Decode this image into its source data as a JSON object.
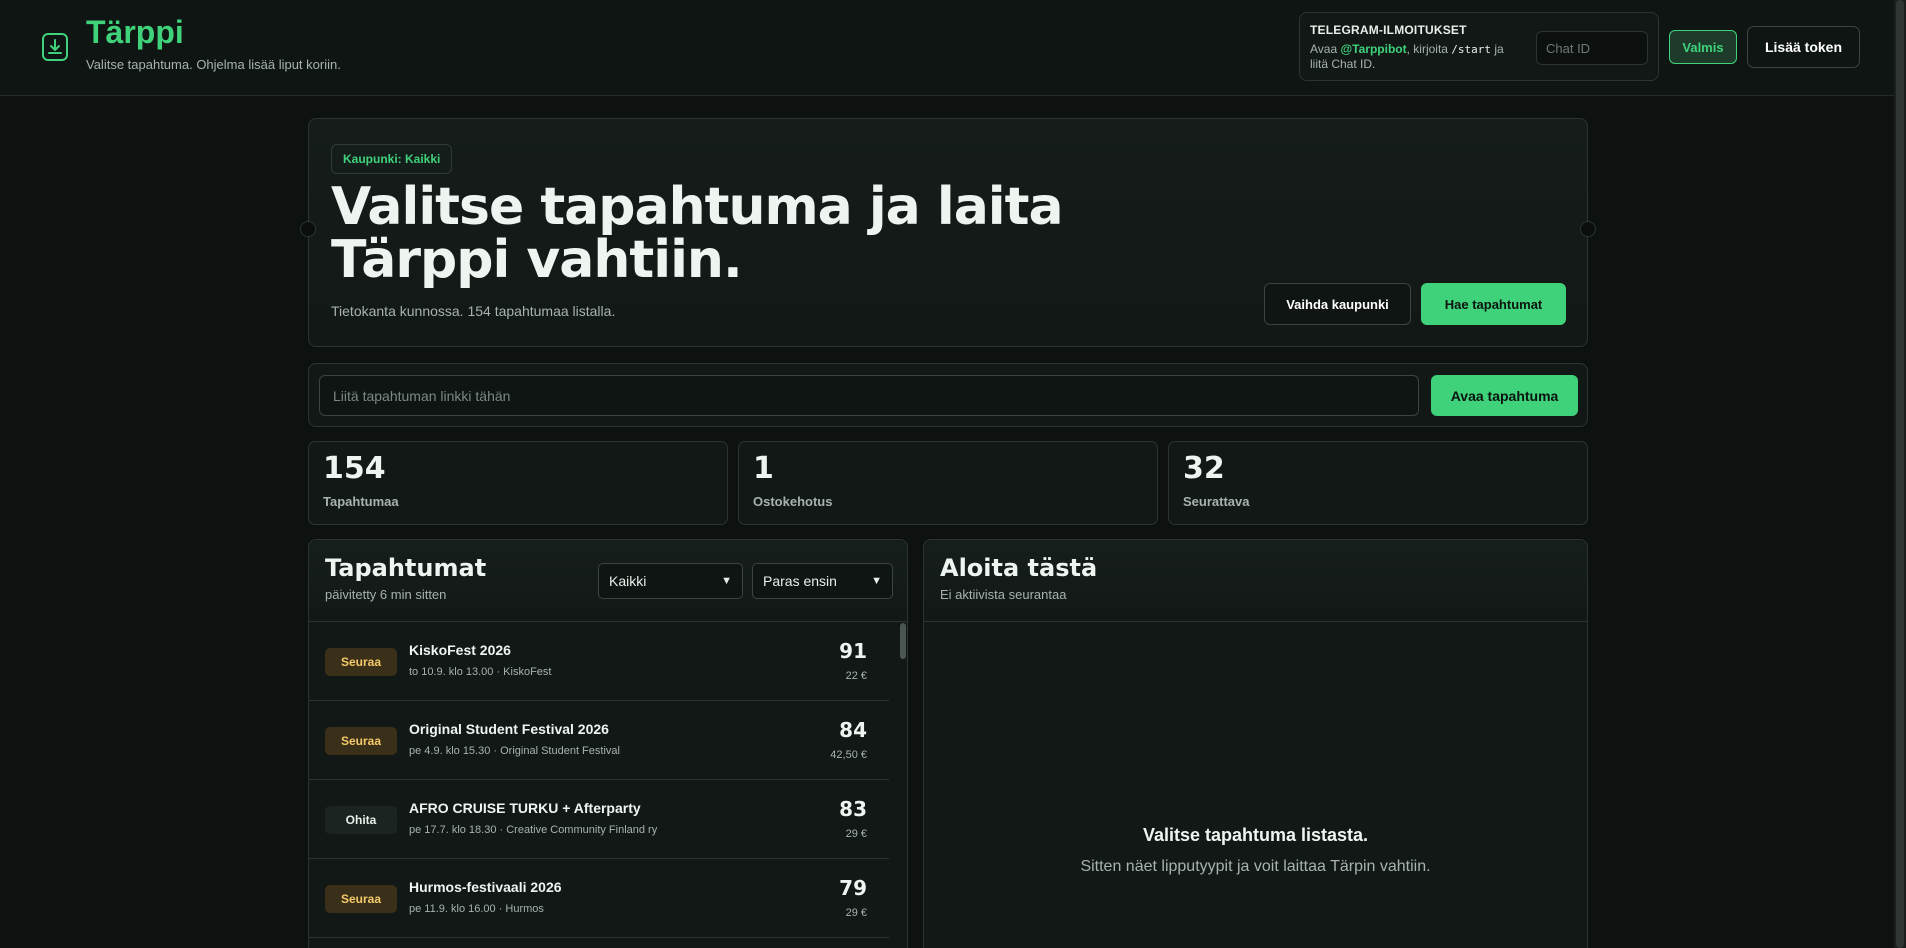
{
  "header": {
    "brand": "Tärppi",
    "subtitle": "Valitse tapahtuma. Ohjelma lisää liput koriin.",
    "telegram": {
      "title": "TELEGRAM-ILMOITUKSET",
      "text_before": "Avaa ",
      "bot": "@Tarppibot",
      "text_mid": ", kirjoita ",
      "command": "/start",
      "text_after": " ja liitä Chat ID.",
      "chat_placeholder": "Chat ID"
    },
    "valmis_label": "Valmis",
    "token_label": "Lisää token"
  },
  "hero": {
    "city_badge": "Kaupunki: Kaikki",
    "title": "Valitse tapahtuma ja laita Tärppi vahtiin.",
    "subtitle": "Tietokanta kunnossa. 154 tapahtumaa listalla.",
    "change_city_label": "Vaihda kaupunki",
    "fetch_label": "Hae tapahtumat"
  },
  "linkbar": {
    "placeholder": "Liitä tapahtuman linkki tähän",
    "open_label": "Avaa tapahtuma"
  },
  "stats": [
    {
      "value": "154",
      "label": "Tapahtumaa"
    },
    {
      "value": "1",
      "label": "Ostokehotus"
    },
    {
      "value": "32",
      "label": "Seurattava"
    }
  ],
  "events_panel": {
    "title": "Tapahtumat",
    "updated": "päivitetty 6 min sitten",
    "filter_selected": "Kaikki",
    "sort_selected": "Paras ensin",
    "events": [
      {
        "badge": "Seuraa",
        "name": "KiskoFest 2026",
        "meta": "to 10.9. klo 13.00 · KiskoFest",
        "score": "91",
        "price": "22 €"
      },
      {
        "badge": "Seuraa",
        "name": "Original Student Festival 2026",
        "meta": "pe 4.9. klo 15.30 · Original Student Festival",
        "score": "84",
        "price": "42,50 €"
      },
      {
        "badge": "Ohita",
        "name": "AFRO CRUISE TURKU + Afterparty",
        "meta": "pe 17.7. klo 18.30 · Creative Community Finland ry",
        "score": "83",
        "price": "29 €"
      },
      {
        "badge": "Seuraa",
        "name": "Hurmos-festivaali 2026",
        "meta": "pe 11.9. klo 16.00 · Hurmos",
        "score": "79",
        "price": "29 €"
      }
    ]
  },
  "start_panel": {
    "title": "Aloita tästä",
    "subtitle": "Ei aktiivista seurantaa",
    "empty_title": "Valitse tapahtuma listasta.",
    "empty_sub": "Sitten näet lipputyypit ja voit laittaa Tärpin vahtiin."
  },
  "colors": {
    "accent": "#3fd27b",
    "background": "#0d1210",
    "badge_seuraa": "#f4c96b"
  },
  "icons": {
    "logo": "ticket-download-icon",
    "select_chevron": "chevron-down-icon"
  }
}
